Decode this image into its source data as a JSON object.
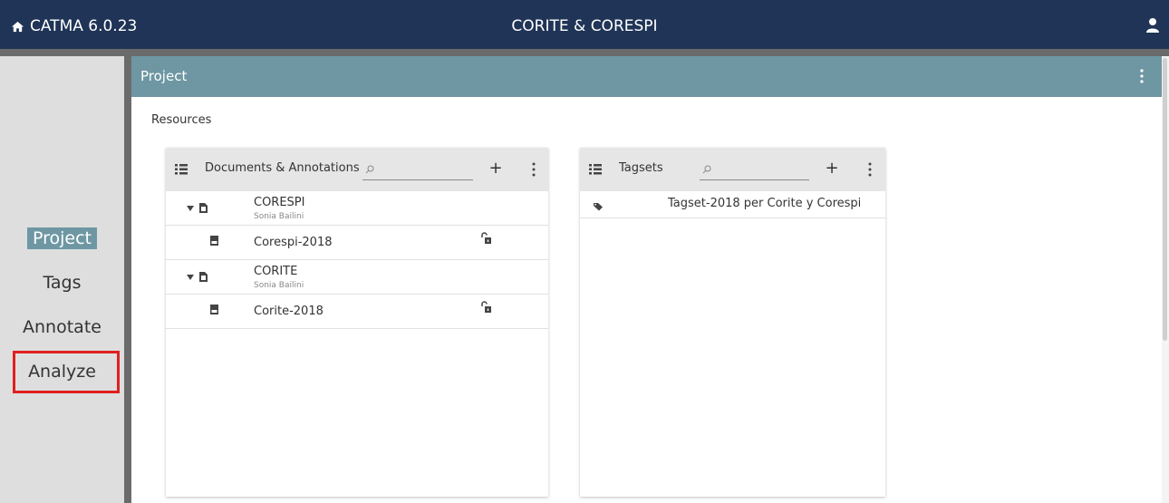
{
  "app": {
    "name": "CATMA 6.0.23",
    "project_title": "CORITE & CORESPI",
    "icons": {
      "home": "home-icon",
      "user": "user-icon"
    },
    "colors": {
      "topbar": "#1f3456",
      "accent": "#6e97a3",
      "highlight_box": "#e02020"
    }
  },
  "nav": {
    "items": [
      {
        "label": "Project",
        "active": true
      },
      {
        "label": "Tags",
        "active": false
      },
      {
        "label": "Annotate",
        "active": false
      },
      {
        "label": "Analyze",
        "active": false,
        "highlighted": true
      }
    ]
  },
  "project": {
    "header": "Project",
    "section_label": "Resources",
    "documents": {
      "title": "Documents & Annotations",
      "search_placeholder": "",
      "add_label": "+",
      "items": [
        {
          "name": "CORESPI",
          "author": "Sonia Bailini",
          "children": [
            {
              "name": "Corespi-2018"
            }
          ]
        },
        {
          "name": "CORITE",
          "author": "Sonia Bailini",
          "children": [
            {
              "name": "Corite-2018"
            }
          ]
        }
      ]
    },
    "tagsets": {
      "title": "Tagsets",
      "search_placeholder": "",
      "add_label": "+",
      "items": [
        {
          "name": "Tagset-2018 per Corite y Corespi"
        }
      ]
    }
  }
}
